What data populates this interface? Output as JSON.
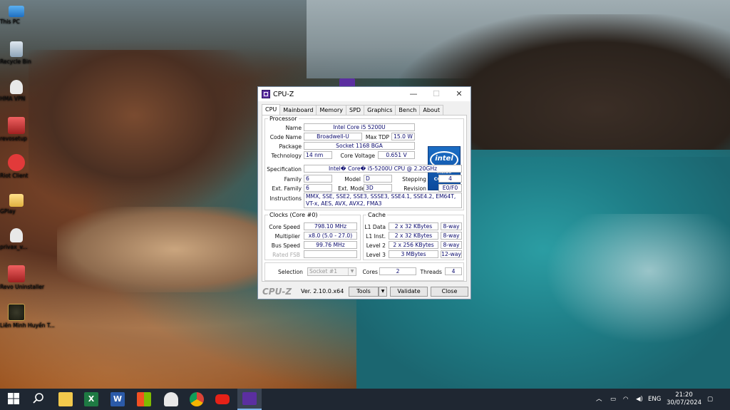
{
  "desktop": {
    "icons": [
      {
        "label": "This PC",
        "icon": "computer-icon",
        "color": "#3b8fe0"
      },
      {
        "label": "Recycle Bin",
        "icon": "recycle-bin-icon",
        "color": "#9db3c7"
      },
      {
        "label": "HMA VPN",
        "icon": "donkey-icon",
        "color": "#f4f4f4"
      },
      {
        "label": "revosetup",
        "icon": "revo-icon",
        "color": "#d23b3b"
      },
      {
        "label": "Riot Client",
        "icon": "riot-icon",
        "color": "#e23a3a"
      },
      {
        "label": "GPlay",
        "icon": "folder-icon",
        "color": "#f2c94c"
      },
      {
        "label": "privax_v...",
        "icon": "donkey-icon",
        "color": "#f4f4f4"
      },
      {
        "label": "Revo Uninstaller",
        "icon": "revo-icon",
        "color": "#d23b3b"
      },
      {
        "label": "Liên Minh Huyền T...",
        "icon": "league-icon",
        "color": "#c8a14a"
      }
    ]
  },
  "window": {
    "title": "CPU-Z",
    "controls": {
      "minimize": "—",
      "maximize": "☐",
      "close": "✕"
    },
    "tabs": [
      "CPU",
      "Mainboard",
      "Memory",
      "SPD",
      "Graphics",
      "Bench",
      "About"
    ],
    "active_tab": "CPU"
  },
  "processor": {
    "legend": "Processor",
    "name_label": "Name",
    "name": "Intel Core i5 5200U",
    "codename_label": "Code Name",
    "codename": "Broadwell-U",
    "maxtdp_label": "Max TDP",
    "maxtdp": "15.0 W",
    "package_label": "Package",
    "package": "Socket 1168 BGA",
    "technology_label": "Technology",
    "technology": "14 nm",
    "corevoltage_label": "Core Voltage",
    "corevoltage": "0.651 V",
    "specification_label": "Specification",
    "specification": "Intel� Core� i5-5200U CPU @ 2.20GHz",
    "family_label": "Family",
    "family": "6",
    "model_label": "Model",
    "model": "D",
    "stepping_label": "Stepping",
    "stepping": "4",
    "extfamily_label": "Ext. Family",
    "extfamily": "6",
    "extmodel_label": "Ext. Model",
    "extmodel": "3D",
    "revision_label": "Revision",
    "revision": "E0/F0",
    "instructions_label": "Instructions",
    "instructions": "MMX, SSE, SSE2, SSE3, SSSE3, SSE4.1, SSE4.2, EM64T, VT-x, AES, AVX, AVX2, FMA3",
    "logo": {
      "brand": "intel",
      "line1": "inside",
      "line2": "CORE i5"
    }
  },
  "clocks": {
    "legend": "Clocks (Core #0)",
    "corespeed_label": "Core Speed",
    "corespeed": "798.10 MHz",
    "multiplier_label": "Multiplier",
    "multiplier": "x8.0 (5.0 - 27.0)",
    "busspeed_label": "Bus Speed",
    "busspeed": "99.76 MHz",
    "ratedfsb_label": "Rated FSB",
    "ratedfsb": ""
  },
  "cache": {
    "legend": "Cache",
    "rows": [
      {
        "label": "L1 Data",
        "size": "2 x 32 KBytes",
        "way": "8-way"
      },
      {
        "label": "L1 Inst.",
        "size": "2 x 32 KBytes",
        "way": "8-way"
      },
      {
        "label": "Level 2",
        "size": "2 x 256 KBytes",
        "way": "8-way"
      },
      {
        "label": "Level 3",
        "size": "3 MBytes",
        "way": "12-way"
      }
    ]
  },
  "selection": {
    "label": "Selection",
    "value": "Socket #1",
    "cores_label": "Cores",
    "cores": "2",
    "threads_label": "Threads",
    "threads": "4"
  },
  "footer": {
    "brand": "CPU-Z",
    "version": "Ver. 2.10.0.x64",
    "tools": "Tools",
    "validate": "Validate",
    "close": "Close"
  },
  "taskbar": {
    "apps": [
      "windows-start-icon",
      "search-icon",
      "file-explorer-icon",
      "excel-icon",
      "word-icon",
      "store-icon",
      "donkey-icon",
      "chrome-icon",
      "youtube-icon",
      "cpuz-icon"
    ],
    "language": "ENG",
    "time": "21:20",
    "date": "30/07/2024"
  }
}
